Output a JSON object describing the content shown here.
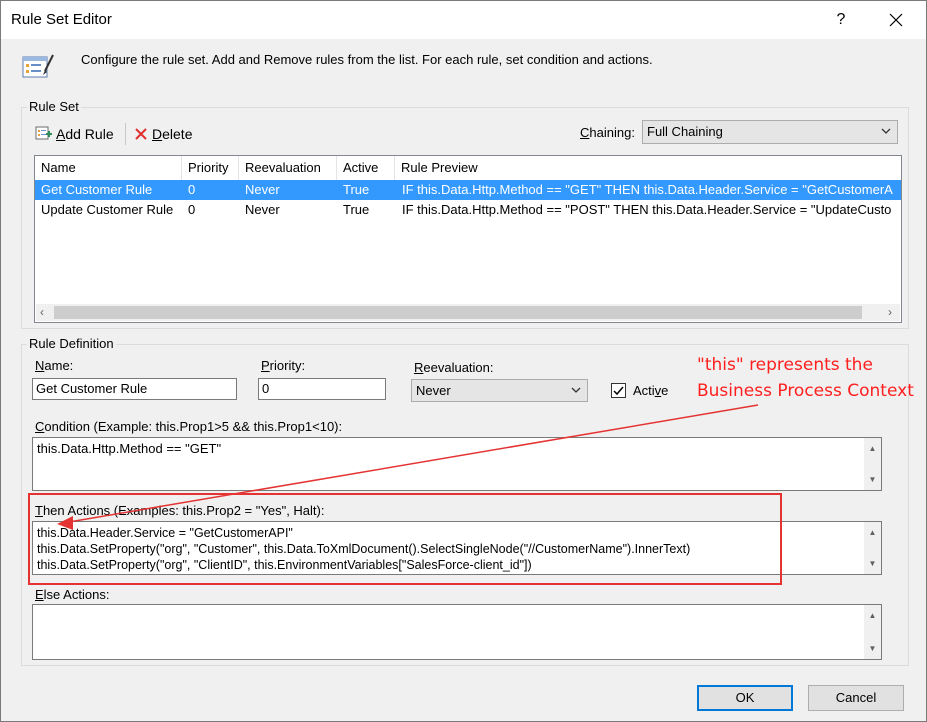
{
  "window": {
    "title": "Rule Set Editor",
    "help_label": "?",
    "description": "Configure the rule set. Add and Remove rules from the list. For each rule, set condition and actions."
  },
  "ruleset": {
    "group_label": "Rule Set",
    "add_rule_prefix": "A",
    "add_rule_rest": "dd Rule",
    "delete_prefix": "D",
    "delete_rest": "elete",
    "chaining_prefix": "C",
    "chaining_rest": "haining:",
    "chaining_value": "Full Chaining",
    "columns": [
      "Name",
      "Priority",
      "Reevaluation",
      "Active",
      "Rule Preview"
    ],
    "rows": [
      {
        "name": "Get Customer Rule",
        "priority": "0",
        "reevaluation": "Never",
        "active": "True",
        "preview": "IF this.Data.Http.Method == \"GET\" THEN this.Data.Header.Service = \"GetCustomerA"
      },
      {
        "name": "Update Customer Rule",
        "priority": "0",
        "reevaluation": "Never",
        "active": "True",
        "preview": "IF this.Data.Http.Method == \"POST\" THEN this.Data.Header.Service = \"UpdateCusto"
      }
    ]
  },
  "definition": {
    "group_label": "Rule Definition",
    "name_prefix": "N",
    "name_rest": "ame:",
    "name_value": "Get Customer Rule",
    "priority_prefix": "P",
    "priority_rest": "riority:",
    "priority_value": "0",
    "reevaluation_prefix": "R",
    "reevaluation_rest": "eevaluation:",
    "reevaluation_value": "Never",
    "active_prefix": "Acti",
    "active_underlined": "v",
    "active_rest": "e",
    "active_checked": true,
    "condition_prefix": "C",
    "condition_rest": "ondition (Example: this.Prop1>5 && this.Prop1<10):",
    "condition_value": "this.Data.Http.Method == \"GET\"",
    "then_prefix": "T",
    "then_rest": "hen Actions (Examples: this.Prop2 = \"Yes\", Halt):",
    "then_lines": [
      "this.Data.Header.Service = \"GetCustomerAPI\"",
      "this.Data.SetProperty(\"org\", \"Customer\", this.Data.ToXmlDocument().SelectSingleNode(\"//CustomerName\").InnerText)",
      "this.Data.SetProperty(\"org\", \"ClientID\", this.EnvironmentVariables[\"SalesForce-client_id\"])"
    ],
    "else_prefix": "E",
    "else_rest": "lse Actions:",
    "else_value": ""
  },
  "buttons": {
    "ok": "OK",
    "cancel": "Cancel"
  },
  "annotation": {
    "line1": "\"this\" represents the",
    "line2": "Business Process Context",
    "color": "#ff1f1f"
  }
}
